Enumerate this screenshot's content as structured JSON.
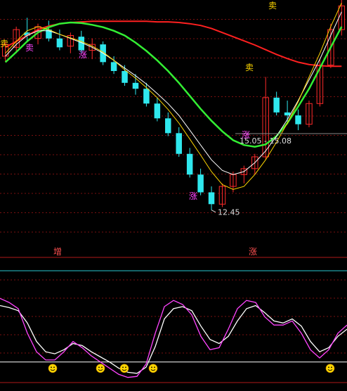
{
  "chart_data": [
    {
      "type": "candlestick",
      "title": "",
      "upper_price_label": "15.05 - 15.08",
      "lower_price_label": "12.45",
      "signal_labels": {
        "sell": "卖",
        "up": "涨"
      },
      "section_labels": {
        "left": "增",
        "right": "涨"
      },
      "ylim": [
        11.9,
        16.0
      ],
      "ma_lines": [
        {
          "color": "#ff2020",
          "values": [
            15.2,
            15.3,
            15.4,
            15.5,
            15.56,
            15.6,
            15.62,
            15.63,
            15.64,
            15.64,
            15.64,
            15.64,
            15.64,
            15.64,
            15.63,
            15.63,
            15.62,
            15.6,
            15.57,
            15.52,
            15.45,
            15.38,
            15.31,
            15.24,
            15.16,
            15.08,
            15.01,
            14.95,
            14.91,
            14.89,
            14.88,
            14.88
          ]
        },
        {
          "color": "#33ee33",
          "values": [
            14.95,
            15.12,
            15.3,
            15.45,
            15.54,
            15.6,
            15.62,
            15.61,
            15.58,
            15.54,
            15.48,
            15.4,
            15.28,
            15.14,
            14.98,
            14.8,
            14.6,
            14.38,
            14.16,
            13.96,
            13.78,
            13.63,
            13.55,
            13.52,
            13.56,
            13.7,
            13.92,
            14.2,
            14.5,
            14.85,
            15.2,
            15.55
          ]
        },
        {
          "color": "#ffffff",
          "values": [
            15.05,
            15.25,
            15.4,
            15.48,
            15.48,
            15.42,
            15.35,
            15.28,
            15.2,
            15.1,
            14.98,
            14.85,
            14.72,
            14.58,
            14.42,
            14.25,
            14.05,
            13.8,
            13.55,
            13.3,
            13.12,
            13.05,
            13.1,
            13.25,
            13.45,
            13.7,
            13.98,
            14.3,
            14.65,
            15.0,
            15.4,
            15.8
          ]
        },
        {
          "color": "#ffd700",
          "values": [
            15.1,
            15.3,
            15.48,
            15.55,
            15.5,
            15.42,
            15.36,
            15.3,
            15.22,
            15.12,
            14.98,
            14.82,
            14.68,
            14.52,
            14.35,
            14.15,
            13.92,
            13.65,
            13.38,
            13.1,
            12.88,
            12.8,
            12.85,
            13.05,
            13.3,
            13.6,
            13.92,
            14.28,
            14.7,
            15.1,
            15.55,
            15.95
          ]
        }
      ],
      "candles": [
        {
          "o": 15.05,
          "h": 15.3,
          "l": 14.95,
          "c": 15.25
        },
        {
          "o": 15.2,
          "h": 15.55,
          "l": 15.1,
          "c": 15.5
        },
        {
          "o": 15.45,
          "h": 15.7,
          "l": 15.3,
          "c": 15.4
        },
        {
          "o": 15.35,
          "h": 15.6,
          "l": 15.25,
          "c": 15.55
        },
        {
          "o": 15.5,
          "h": 15.65,
          "l": 15.3,
          "c": 15.35
        },
        {
          "o": 15.35,
          "h": 15.5,
          "l": 15.15,
          "c": 15.2
        },
        {
          "o": 15.22,
          "h": 15.45,
          "l": 15.1,
          "c": 15.4
        },
        {
          "o": 15.38,
          "h": 15.48,
          "l": 15.1,
          "c": 15.15
        },
        {
          "o": 15.15,
          "h": 15.35,
          "l": 15.0,
          "c": 15.25
        },
        {
          "o": 15.25,
          "h": 15.3,
          "l": 14.9,
          "c": 14.95
        },
        {
          "o": 14.95,
          "h": 15.05,
          "l": 14.75,
          "c": 14.8
        },
        {
          "o": 14.8,
          "h": 14.9,
          "l": 14.55,
          "c": 14.6
        },
        {
          "o": 14.6,
          "h": 14.75,
          "l": 14.4,
          "c": 14.5
        },
        {
          "o": 14.5,
          "h": 14.6,
          "l": 14.2,
          "c": 14.25
        },
        {
          "o": 14.25,
          "h": 14.35,
          "l": 13.95,
          "c": 14.0
        },
        {
          "o": 14.0,
          "h": 14.1,
          "l": 13.7,
          "c": 13.75
        },
        {
          "o": 13.75,
          "h": 13.85,
          "l": 13.35,
          "c": 13.4
        },
        {
          "o": 13.4,
          "h": 13.5,
          "l": 13.0,
          "c": 13.05
        },
        {
          "o": 13.05,
          "h": 13.15,
          "l": 12.7,
          "c": 12.75
        },
        {
          "o": 12.75,
          "h": 12.85,
          "l": 12.45,
          "c": 12.55
        },
        {
          "o": 12.55,
          "h": 12.9,
          "l": 12.5,
          "c": 12.85
        },
        {
          "o": 12.85,
          "h": 13.1,
          "l": 12.75,
          "c": 13.05
        },
        {
          "o": 13.05,
          "h": 13.2,
          "l": 12.9,
          "c": 13.15
        },
        {
          "o": 13.15,
          "h": 13.4,
          "l": 13.05,
          "c": 13.35
        },
        {
          "o": 13.35,
          "h": 14.7,
          "l": 13.3,
          "c": 14.35
        },
        {
          "o": 14.35,
          "h": 14.45,
          "l": 14.05,
          "c": 14.1
        },
        {
          "o": 14.1,
          "h": 14.3,
          "l": 13.9,
          "c": 14.05
        },
        {
          "o": 14.05,
          "h": 14.15,
          "l": 13.8,
          "c": 13.9
        },
        {
          "o": 13.9,
          "h": 14.3,
          "l": 13.85,
          "c": 14.25
        },
        {
          "o": 14.25,
          "h": 15.0,
          "l": 14.2,
          "c": 14.9
        },
        {
          "o": 14.9,
          "h": 15.6,
          "l": 14.85,
          "c": 15.5
        },
        {
          "o": 15.5,
          "h": 16.0,
          "l": 15.4,
          "c": 15.9
        }
      ]
    },
    {
      "type": "line",
      "title": "",
      "ylim": [
        0,
        100
      ],
      "series": [
        {
          "color": "#ffffff",
          "values": [
            75,
            73,
            70,
            58,
            40,
            30,
            28,
            32,
            38,
            36,
            30,
            25,
            20,
            14,
            10,
            9,
            15,
            35,
            62,
            72,
            74,
            70,
            55,
            42,
            38,
            45,
            60,
            72,
            75,
            68,
            60,
            58,
            62,
            55,
            40,
            30,
            34,
            45,
            52
          ]
        },
        {
          "color": "#ff44ff",
          "values": [
            82,
            78,
            72,
            48,
            30,
            22,
            22,
            30,
            40,
            34,
            26,
            20,
            14,
            8,
            5,
            6,
            18,
            48,
            74,
            80,
            76,
            66,
            45,
            32,
            34,
            52,
            72,
            80,
            78,
            64,
            56,
            56,
            60,
            48,
            32,
            24,
            32,
            48,
            56
          ]
        }
      ],
      "reference_lines": [
        20,
        0
      ]
    }
  ]
}
